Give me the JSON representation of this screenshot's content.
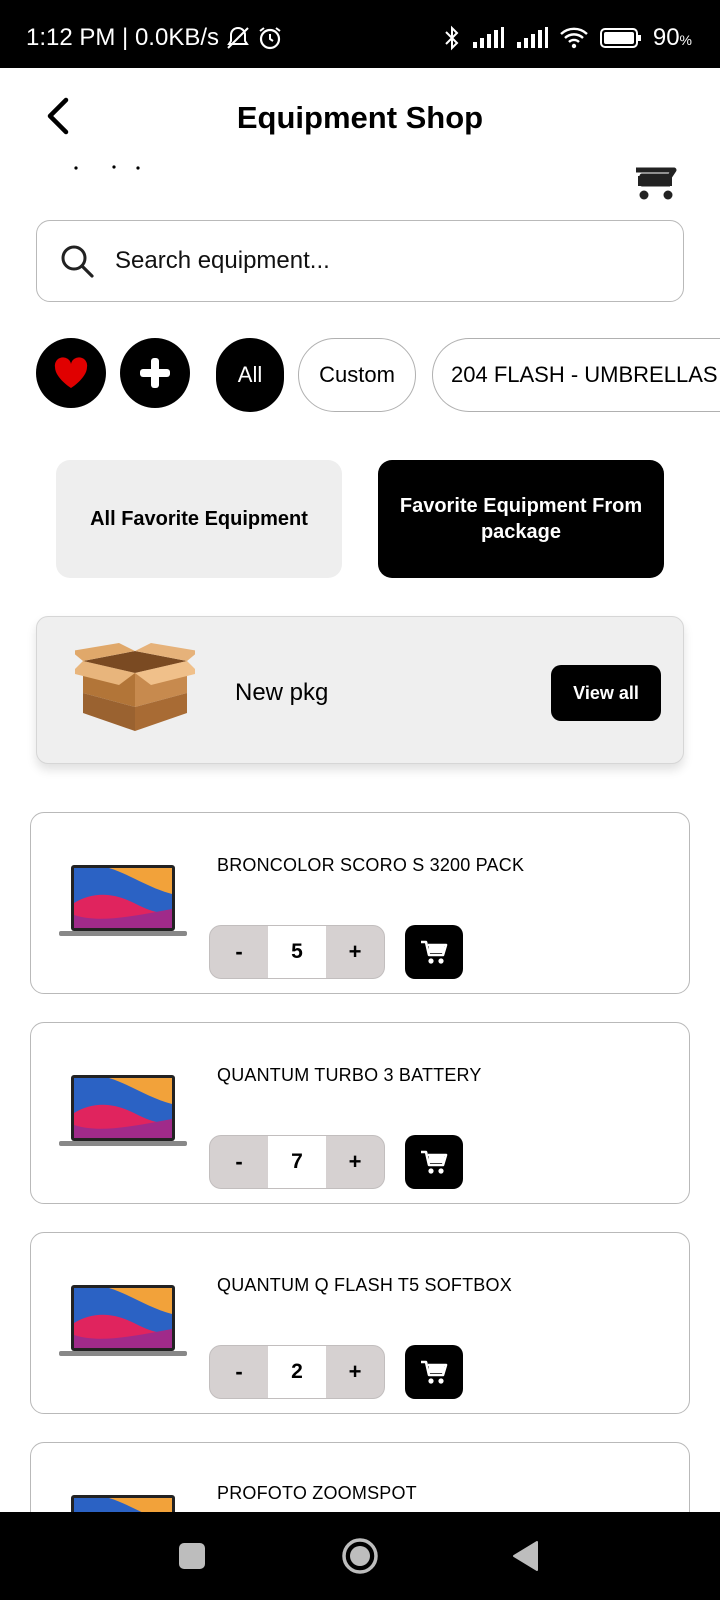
{
  "status_bar": {
    "time_and_speed": "1:12 PM | 0.0KB/s",
    "battery": "90",
    "battery_unit": "%"
  },
  "header": {
    "title": "Equipment Shop"
  },
  "search": {
    "placeholder": "Search equipment..."
  },
  "filters": {
    "chips": [
      "All",
      "Custom",
      "204 FLASH - UMBRELLAS /"
    ],
    "active_index": 0
  },
  "toggles": {
    "left_label": "All Favorite Equipment",
    "right_label": "Favorite Equipment From package"
  },
  "package": {
    "name": "New pkg",
    "view_all_label": "View all"
  },
  "products": [
    {
      "name": "BRONCOLOR SCORO S 3200 PACK",
      "quantity": "5"
    },
    {
      "name": "QUANTUM TURBO 3 BATTERY",
      "quantity": "7"
    },
    {
      "name": "QUANTUM Q FLASH T5 SOFTBOX",
      "quantity": "2"
    },
    {
      "name": "PROFOTO ZOOMSPOT",
      "quantity": ""
    }
  ],
  "stepper": {
    "minus": "-",
    "plus": "+"
  },
  "colors": {
    "accent": "#000000",
    "favorite_red": "#e00000",
    "chip_light_bg": "#eeeeee",
    "stepper_bg": "#d6d1d1"
  },
  "icons": {
    "back": "chevron-left-icon",
    "cart": "cart-icon",
    "search": "search-icon",
    "favorite": "heart-icon",
    "add": "plus-icon",
    "package": "box-icon",
    "product": "laptop-icon"
  }
}
